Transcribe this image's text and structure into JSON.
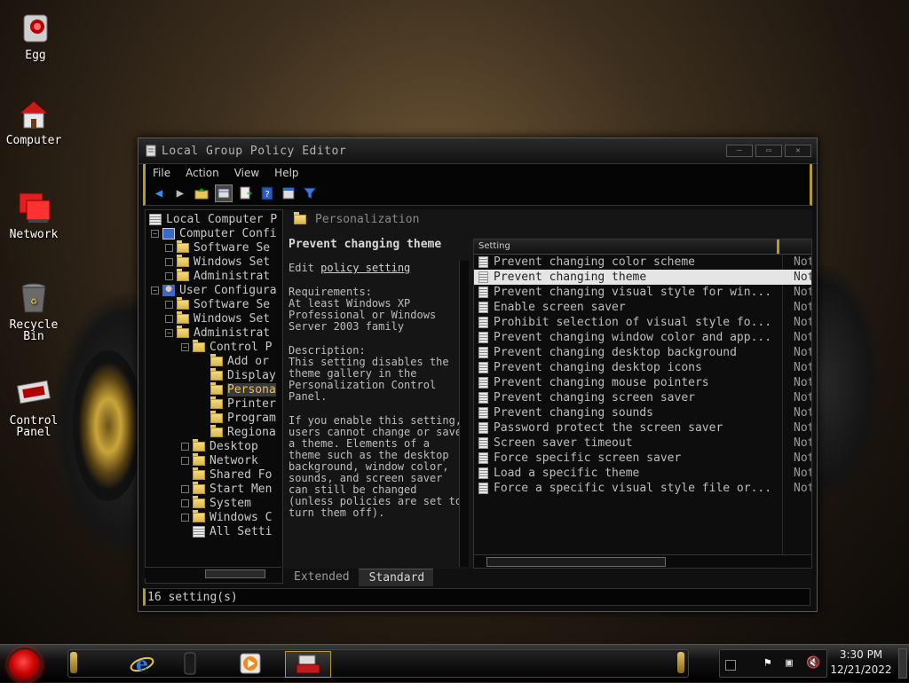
{
  "desktop": {
    "icons": [
      {
        "label": "Egg"
      },
      {
        "label": "Computer"
      },
      {
        "label": "Network"
      },
      {
        "label": "Recycle Bin"
      },
      {
        "label": "Control Panel"
      }
    ]
  },
  "window": {
    "title": "Local Group Policy Editor",
    "menu": [
      "File",
      "Action",
      "View",
      "Help"
    ],
    "toolbar_icons": [
      "back-arrow-icon",
      "forward-arrow-icon",
      "up-folder-icon",
      "show-hide-tree-icon",
      "export-list-icon",
      "help-icon",
      "properties-icon",
      "filter-icon"
    ],
    "tree": [
      {
        "label": "Local Computer P",
        "indent": 0,
        "kind": "root"
      },
      {
        "label": "Computer Confi",
        "indent": 1,
        "kind": "computer",
        "exp": "-"
      },
      {
        "label": "Software Se",
        "indent": 2,
        "kind": "folder",
        "exp": ""
      },
      {
        "label": "Windows Set",
        "indent": 2,
        "kind": "folder",
        "exp": ""
      },
      {
        "label": "Administrat",
        "indent": 2,
        "kind": "folder",
        "exp": ""
      },
      {
        "label": "User Configura",
        "indent": 1,
        "kind": "user",
        "exp": "-"
      },
      {
        "label": "Software Se",
        "indent": 2,
        "kind": "folder",
        "exp": ""
      },
      {
        "label": "Windows Set",
        "indent": 2,
        "kind": "folder",
        "exp": ""
      },
      {
        "label": "Administrat",
        "indent": 2,
        "kind": "folder",
        "exp": "-"
      },
      {
        "label": "Control P",
        "indent": 3,
        "kind": "folder",
        "exp": "-"
      },
      {
        "label": "Add or",
        "indent": 4,
        "kind": "folder",
        "exp": "none"
      },
      {
        "label": "Display",
        "indent": 4,
        "kind": "folder",
        "exp": "none"
      },
      {
        "label": "Persona",
        "indent": 4,
        "kind": "folder",
        "exp": "none",
        "selected": true
      },
      {
        "label": "Printer",
        "indent": 4,
        "kind": "folder",
        "exp": "none"
      },
      {
        "label": "Program",
        "indent": 4,
        "kind": "folder",
        "exp": "none"
      },
      {
        "label": "Regiona",
        "indent": 4,
        "kind": "folder",
        "exp": "none"
      },
      {
        "label": "Desktop",
        "indent": 3,
        "kind": "folder",
        "exp": ""
      },
      {
        "label": "Network",
        "indent": 3,
        "kind": "folder",
        "exp": ""
      },
      {
        "label": "Shared Fo",
        "indent": 3,
        "kind": "folder",
        "exp": "none"
      },
      {
        "label": "Start Men",
        "indent": 3,
        "kind": "folder",
        "exp": ""
      },
      {
        "label": "System",
        "indent": 3,
        "kind": "folder",
        "exp": ""
      },
      {
        "label": "Windows C",
        "indent": 3,
        "kind": "folder",
        "exp": ""
      },
      {
        "label": "All Setti",
        "indent": 3,
        "kind": "allsettings",
        "exp": "none"
      }
    ],
    "pane_header": "Personalization",
    "description": {
      "policy_title": "Prevent changing theme",
      "edit_prefix": "Edit",
      "edit_link": "policy setting",
      "requirements": "Requirements:\nAt least Windows XP Professional or Windows Server 2003 family",
      "description": "Description:\nThis setting disables the theme gallery in the Personalization Control Panel.",
      "detail": "If you enable this setting, users cannot change or save a theme. Elements of a theme such as the desktop background, window color, sounds, and screen saver can still be changed (unless policies are set to turn them off)."
    },
    "list_header": "Setting",
    "settings": [
      {
        "name": "Prevent changing color scheme",
        "state": "Not"
      },
      {
        "name": "Prevent changing theme",
        "state": "Not",
        "selected": true
      },
      {
        "name": "Prevent changing visual style for win...",
        "state": "Not"
      },
      {
        "name": "Enable screen saver",
        "state": "Not"
      },
      {
        "name": "Prohibit selection of visual style fo...",
        "state": "Not"
      },
      {
        "name": "Prevent changing window color and app...",
        "state": "Not"
      },
      {
        "name": "Prevent changing desktop background",
        "state": "Not"
      },
      {
        "name": "Prevent changing desktop icons",
        "state": "Not"
      },
      {
        "name": "Prevent changing mouse pointers",
        "state": "Not"
      },
      {
        "name": "Prevent changing screen saver",
        "state": "Not"
      },
      {
        "name": "Prevent changing sounds",
        "state": "Not"
      },
      {
        "name": "Password protect the screen saver",
        "state": "Not"
      },
      {
        "name": "Screen saver timeout",
        "state": "Not"
      },
      {
        "name": "Force specific screen saver",
        "state": "Not"
      },
      {
        "name": "Load a specific theme",
        "state": "Not"
      },
      {
        "name": "Force a specific visual style file or...",
        "state": "Not"
      }
    ],
    "tabs": {
      "extended": "Extended",
      "standard": "Standard"
    },
    "status": "16 setting(s)"
  },
  "taskbar": {
    "pinned": [
      "internet-explorer-icon",
      "dark-app-icon",
      "media-player-icon",
      "policy-editor-icon"
    ],
    "tray_icons": [
      "flag-icon",
      "network-icon",
      "volume-muted-icon"
    ],
    "time": "3:30 PM",
    "date": "12/21/2022"
  },
  "colors": {
    "accent": "#b89a2a",
    "selection": "#e5e5e5",
    "window_bg": "#0e0e0e"
  }
}
